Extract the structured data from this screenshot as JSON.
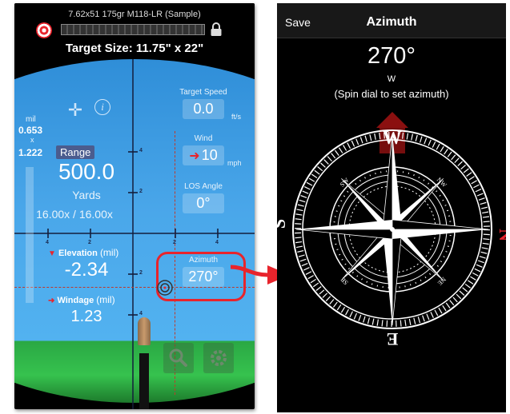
{
  "left": {
    "ammo": "7.62x51 175gr M118-LR (Sample)",
    "target_size": "Target Size: 11.75\" x 22\"",
    "mil_label": "mil",
    "mil_value": "0.653",
    "mil_x": "x",
    "mil_value2": "1.222",
    "range_button": "Range",
    "range_value": "500.0",
    "range_unit": "Yards",
    "zoom": "16.00x / 16.00x",
    "target_speed": {
      "label": "Target Speed",
      "value": "0.0",
      "unit": "ft/s"
    },
    "wind": {
      "label": "Wind",
      "value": "10",
      "unit": "mph"
    },
    "los_angle": {
      "label": "LOS Angle",
      "value": "0°"
    },
    "azimuth": {
      "label": "Azimuth",
      "value": "270°"
    },
    "elevation": {
      "label": "Elevation",
      "unit": "(mil)",
      "value": "-2.34"
    },
    "windage": {
      "label": "Windage",
      "unit": "(mil)",
      "value": "1.23"
    },
    "ticks": {
      "t4a": "4",
      "t2a": "2",
      "t2b": "2",
      "t4b": "4",
      "h4a": "4",
      "h2a": "2",
      "h2b": "2",
      "h4b": "4"
    }
  },
  "right": {
    "save": "Save",
    "title": "Azimuth",
    "azimuth_value": "270°",
    "direction": "W",
    "hint": "(Spin dial to set azimuth)",
    "compass": {
      "W": "W",
      "N": "N",
      "S": "S",
      "E": "E",
      "NW": "NW",
      "SW": "SW",
      "NE": "NE",
      "SE": "SE"
    }
  },
  "colors": {
    "accent_red": "#e8242c",
    "sky": "#4aa7ea",
    "ground": "#36c24e"
  }
}
